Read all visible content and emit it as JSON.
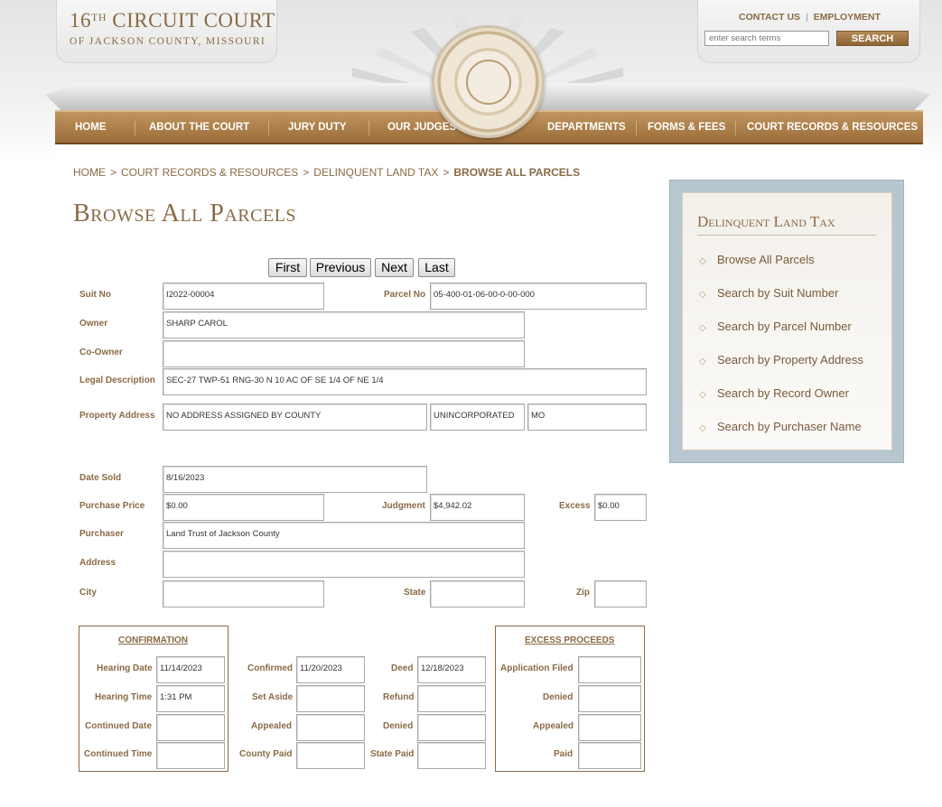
{
  "header": {
    "title_main": "CIRCUIT COURT",
    "title_number": "16",
    "title_suffix": "TH",
    "title_sub": "OF JACKSON COUNTY, MISSOURI",
    "contact_label": "CONTACT US",
    "employment_label": "EMPLOYMENT",
    "search_placeholder": "enter search terms",
    "search_button": "SEARCH"
  },
  "nav": {
    "items": [
      "HOME",
      "ABOUT THE COURT",
      "JURY DUTY",
      "OUR JUDGES",
      "DEPARTMENTS",
      "FORMS & FEES",
      "COURT RECORDS & RESOURCES"
    ]
  },
  "breadcrumb": [
    "HOME",
    "COURT RECORDS & RESOURCES",
    "DELINQUENT LAND TAX",
    "BROWSE ALL PARCELS"
  ],
  "page_title": "Browse All Parcels",
  "pager": [
    "First",
    "Previous",
    "Next",
    "Last"
  ],
  "form": {
    "suit_no_label": "Suit No",
    "suit_no": "I2022-00004",
    "parcel_no_label": "Parcel No",
    "parcel_no": "05-400-01-06-00-0-00-000",
    "owner_label": "Owner",
    "owner": "SHARP CAROL",
    "co_owner_label": "Co-Owner",
    "co_owner": "",
    "legal_label": "Legal Description",
    "legal": "SEC-27 TWP-51 RNG-30 N 10 AC OF SE 1/4 OF NE 1/4",
    "property_address_label": "Property Address",
    "property_address": "NO ADDRESS ASSIGNED BY COUNTY",
    "property_city": "UNINCORPORATED",
    "property_state": "MO",
    "date_sold_label": "Date Sold",
    "date_sold": "8/16/2023",
    "purchase_price_label": "Purchase Price",
    "purchase_price": "$0.00",
    "judgment_label": "Judgment",
    "judgment": "$4,942.02",
    "excess_label": "Excess",
    "excess": "$0.00",
    "purchaser_label": "Purchaser",
    "purchaser": "Land Trust of Jackson County",
    "address_label": "Address",
    "address": "",
    "city_label": "City",
    "city": "",
    "state_label": "State",
    "state": "",
    "zip_label": "Zip",
    "zip": ""
  },
  "confirmation": {
    "title": "CONFIRMATION",
    "hearing_date_label": "Hearing Date",
    "hearing_date": "11/14/2023",
    "hearing_time_label": "Hearing Time",
    "hearing_time": "1:31 PM",
    "continued_date_label": "Continued Date",
    "continued_date": "",
    "continued_time_label": "Continued Time",
    "continued_time": "",
    "confirmed_label": "Confirmed",
    "confirmed": "11/20/2023",
    "set_aside_label": "Set Aside",
    "set_aside": "",
    "appealed_label": "Appealed",
    "appealed": "",
    "county_paid_label": "County Paid",
    "county_paid": "",
    "deed_label": "Deed",
    "deed": "12/18/2023",
    "refund_label": "Refund",
    "refund": "",
    "denied_label": "Denied",
    "denied": "",
    "state_paid_label": "State Paid",
    "state_paid": ""
  },
  "excess_proceeds": {
    "title": "EXCESS PROCEEDS",
    "application_filed_label": "Application Filed",
    "application_filed": "",
    "denied_label": "Denied",
    "denied": "",
    "appealed_label": "Appealed",
    "appealed": "",
    "paid_label": "Paid",
    "paid": ""
  },
  "sidebar": {
    "title": "Delinquent Land Tax",
    "links": [
      "Browse All Parcels",
      "Search by Suit Number",
      "Search by Parcel Number",
      "Search by Property Address",
      "Search by Record Owner",
      "Search by Purchaser Name"
    ]
  }
}
